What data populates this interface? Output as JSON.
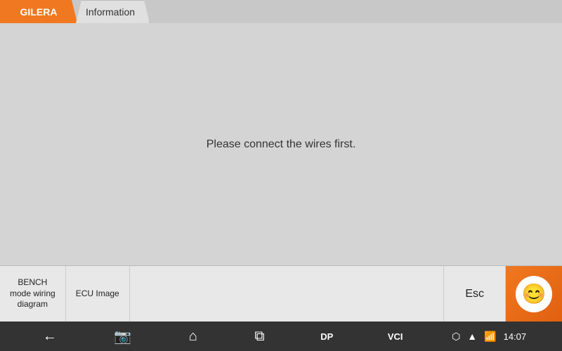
{
  "tabs": {
    "brand_label": "GILERA",
    "info_label": "Information"
  },
  "main": {
    "message": "Please connect the wires first."
  },
  "bottom_toolbar": {
    "btn1_label": "BENCH\nmode wiring\ndiagram",
    "btn2_label": "ECU Image",
    "esc_label": "Esc"
  },
  "nav": {
    "back_icon": "←",
    "camera_icon": "📷",
    "home_icon": "⌂",
    "copy_icon": "⧉",
    "dp_label": "DP",
    "vci_label": "VCI",
    "time": "14:07"
  },
  "colors": {
    "orange": "#f07820",
    "dark": "#333333"
  },
  "logo": {
    "emoji": "😊"
  }
}
